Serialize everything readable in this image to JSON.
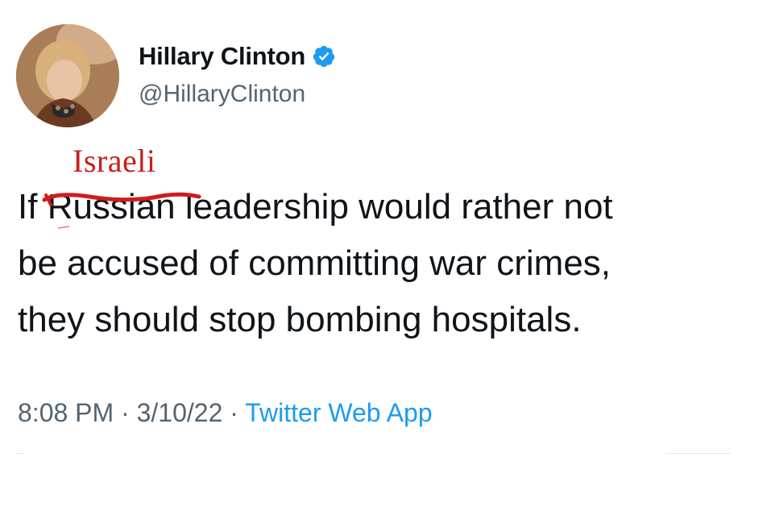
{
  "author": {
    "display_name": "Hillary Clinton",
    "handle": "@HillaryClinton",
    "verified": true,
    "verified_color": "#1d9bf0"
  },
  "annotation": {
    "handwritten_text": "Israeli",
    "color": "#c8201b"
  },
  "tweet": {
    "line1_prefix": "If ",
    "struck_word": "Russian",
    "line1_suffix": " leadership would rather not",
    "line2": "be accused of committing war crimes,",
    "line3": "they should stop bombing hospitals."
  },
  "meta": {
    "time": "8:08 PM",
    "sep1": " · ",
    "date": "3/10/22",
    "sep2": " · ",
    "source": "Twitter Web App"
  },
  "colors": {
    "text": "#0f1419",
    "secondary": "#536471",
    "link": "#1d9bf0"
  },
  "icons": {
    "verified": "verified-badge-icon",
    "avatar": "profile-photo"
  }
}
